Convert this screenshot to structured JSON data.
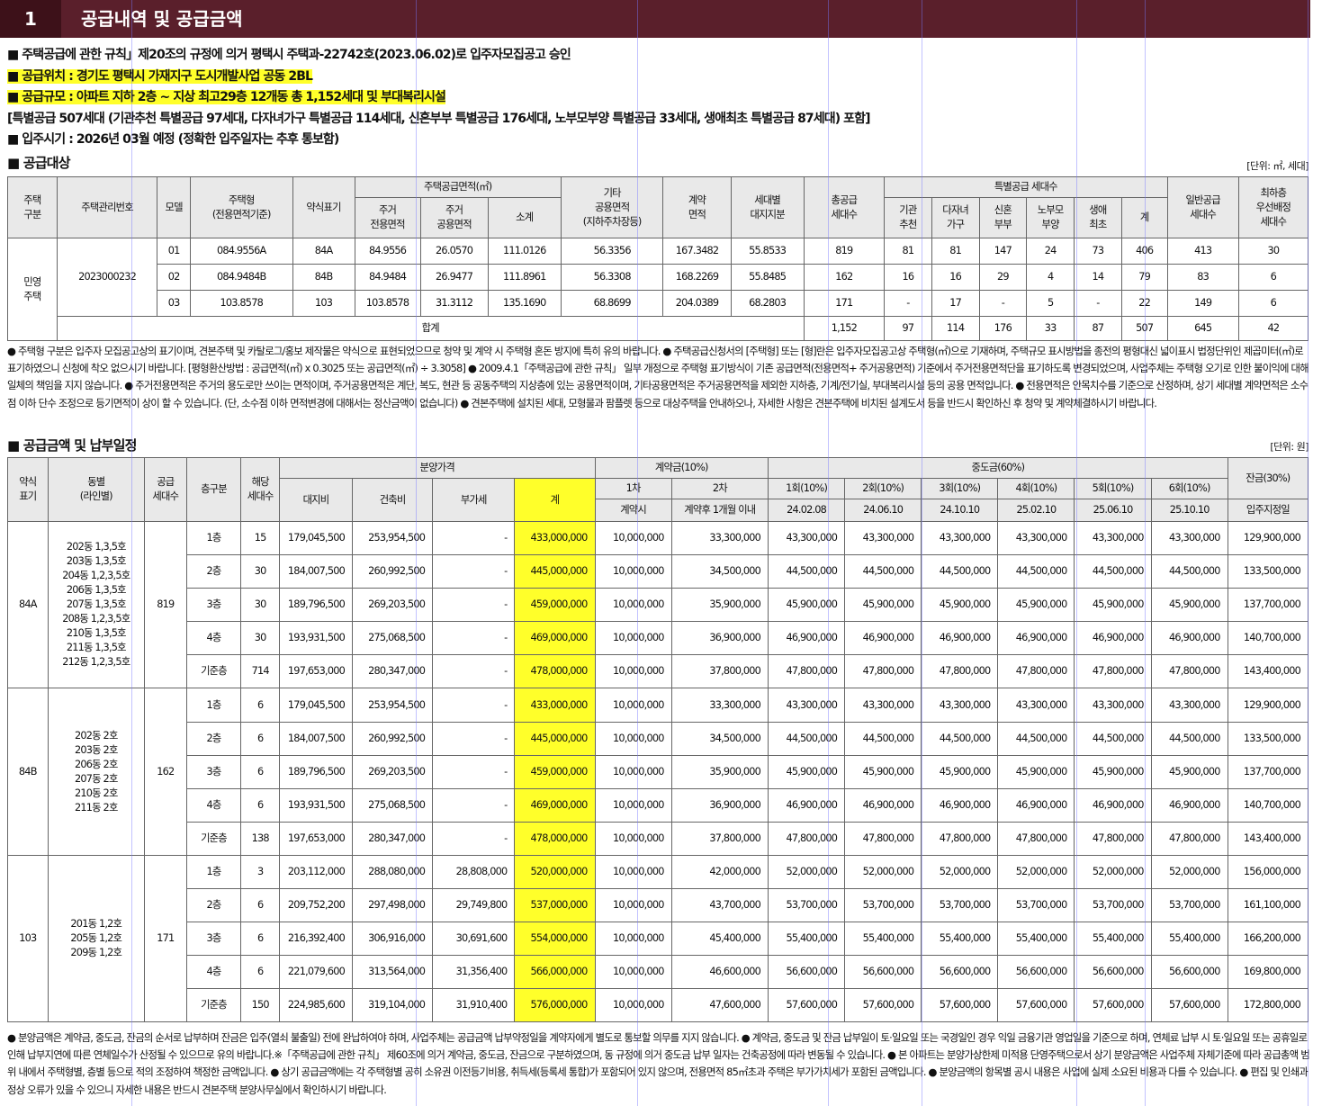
{
  "section": {
    "number": "1",
    "title": "공급내역 및 공급금액"
  },
  "intro": [
    "■ 주택공급에 관한 규칙」제20조의 규정에 의거 평택시 주택과-22742호(2023.06.02)로 입주자모집공고 승인",
    "■ 공급위치 : 경기도 평택시 가재지구 도시개발사업 공동 2BL",
    "■ 공급규모 : 아파트 지하 2층 ~ 지상 최고29층 12개동 총 1,152세대 및 부대복리시설",
    "[특별공급 507세대 (기관추천 특별공급 97세대, 다자녀가구 특별공급 114세대, 신혼부부 특별공급 176세대, 노부모부양 특별공급 33세대, 생애최초 특별공급 87세대) 포함]",
    "■ 입주시기 : 2026년 03월 예정 (정확한 입주일자는 추후 통보함)"
  ],
  "target": {
    "title": "■ 공급대상",
    "unit": "[단위: ㎡, 세대]",
    "h": {
      "type": "주택\n구분",
      "mgmt": "주택관리번호",
      "model": "모델",
      "htype": "주택형\n(전용면적기준)",
      "short": "약식표기",
      "area": "주택공급면적(㎡)",
      "excl": "주거\n전용면적",
      "comm": "주거\n공용면적",
      "sub": "소계",
      "etc": "기타\n공용면적\n(지하주차장등)",
      "contract": "계약\n면적",
      "land": "세대별\n대지지분",
      "total": "총공급\n세대수",
      "special": "특별공급 세대수",
      "inst": "기관\n추천",
      "multi": "다자녀\n가구",
      "newly": "신혼\n부부",
      "elder": "노부모\n부양",
      "first": "생애\n최초",
      "ssum": "계",
      "general": "일반공급\n세대수",
      "lowest": "최하층\n우선배정\n세대수"
    },
    "category": "민영\n주택",
    "mgmt_no": "2023000232",
    "rows": [
      [
        "01",
        "084.9556A",
        "84A",
        "84.9556",
        "26.0570",
        "111.0126",
        "56.3356",
        "167.3482",
        "55.8533",
        "819",
        "81",
        "81",
        "147",
        "24",
        "73",
        "406",
        "413",
        "30"
      ],
      [
        "02",
        "084.9484B",
        "84B",
        "84.9484",
        "26.9477",
        "111.8961",
        "56.3308",
        "168.2269",
        "55.8485",
        "162",
        "16",
        "16",
        "29",
        "4",
        "14",
        "79",
        "83",
        "6"
      ],
      [
        "03",
        "103.8578",
        "103",
        "103.8578",
        "31.3112",
        "135.1690",
        "68.8699",
        "204.0389",
        "68.2803",
        "171",
        "-",
        "17",
        "-",
        "5",
        "-",
        "22",
        "149",
        "6"
      ]
    ],
    "total_label": "합계",
    "total": [
      "1,152",
      "97",
      "114",
      "176",
      "33",
      "87",
      "507",
      "645",
      "42"
    ]
  },
  "notes1": "● 주택형 구분은 입주자 모집공고상의 표기이며, 견본주택 및 카탈로그/홍보 제작물은 약식으로 표현되었으므로 청약 및 계약 시 주택형 혼돈 방지에 특히 유의 바랍니다. ● 주택공급신청서의 [주택형] 또는 [형]란은 입주자모집공고상 주택형(㎡)으로 기재하며, 주택규모 표시방법을 종전의 평형대신 넓이표시 법정단위인 제곱미터(㎡)로 표기하였으니 신청에 착오 없으시기 바랍니다. [평형환산방법 : 공급면적(㎡) x 0.3025 또는 공급면적(㎡) ÷ 3.3058] ● 2009.4.1「주택공급에 관한 규칙」 일부 개정으로 주택형 표기방식이 기존 공급면적(전용면적+ 주거공용면적) 기준에서 주거전용면적단을 표기하도록 변경되었으며, 사업주체는 주택형 오기로 인한 불이익에 대해 일체의 책임을 지지 않습니다. ● 주거전용면적은 주거의 용도로만 쓰이는 면적이며, 주거공용면적은 계단, 복도, 현관 등 공동주택의 지상층에 있는 공용면적이며, 기타공용면적은 주거공용면적을 제외한 지하층, 기계/전기실, 부대복리시설 등의 공용 면적입니다. ● 전용면적은 안목치수를 기준으로 산정하며, 상기 세대별 계약면적은 소수점 이하 단수 조정으로 등기면적이 상이 할 수 있습니다. (단, 소수점 이하 면적변경에 대해서는 정산금액이 없습니다) ● 견본주택에 설치된 세대, 모형물과 팜플렛 등으로 대상주택을 안내하오나, 자세한 사항은 견본주택에 비치된 설계도서 등을 반드시 확인하신 후 청약 및 계약체결하시기 바랍니다.",
  "price": {
    "title": "■ 공급금액 및 납부일정",
    "unit": "[단위: 원]",
    "h": {
      "short": "약식\n표기",
      "dong": "동별\n(라인별)",
      "supply": "공급\n세대수",
      "floor": "층구분",
      "hh": "해당\n세대수",
      "sale": "분양가격",
      "landc": "대지비",
      "build": "건축비",
      "vat": "부가세",
      "sum": "계",
      "contract": "계약금(10%)",
      "c1": "1차",
      "c2": "2차",
      "c1d": "계약시",
      "c2d": "계약후 1개월 이내",
      "mid": "중도금(60%)",
      "m": [
        "1회(10%)",
        "2회(10%)",
        "3회(10%)",
        "4회(10%)",
        "5회(10%)",
        "6회(10%)"
      ],
      "md": [
        "24.02.08",
        "24.06.10",
        "24.10.10",
        "25.02.10",
        "25.06.10",
        "25.10.10"
      ],
      "bal": "잔금(30%)",
      "bald": "입주지정일"
    },
    "groups": [
      {
        "short": "84A",
        "dong": [
          "202동 1,3,5호",
          "203동 1,3,5호",
          "204동 1,2,3,5호",
          "206동 1,3,5호",
          "207동 1,3,5호",
          "208동 1,2,3,5호",
          "210동 1,3,5호",
          "211동 1,3,5호",
          "212동 1,2,3,5호"
        ],
        "supply": "819",
        "rows": [
          [
            "1층",
            "15",
            "179,045,500",
            "253,954,500",
            "-",
            "433,000,000",
            "10,000,000",
            "33,300,000",
            "43,300,000",
            "43,300,000",
            "43,300,000",
            "43,300,000",
            "43,300,000",
            "43,300,000",
            "129,900,000"
          ],
          [
            "2층",
            "30",
            "184,007,500",
            "260,992,500",
            "-",
            "445,000,000",
            "10,000,000",
            "34,500,000",
            "44,500,000",
            "44,500,000",
            "44,500,000",
            "44,500,000",
            "44,500,000",
            "44,500,000",
            "133,500,000"
          ],
          [
            "3층",
            "30",
            "189,796,500",
            "269,203,500",
            "-",
            "459,000,000",
            "10,000,000",
            "35,900,000",
            "45,900,000",
            "45,900,000",
            "45,900,000",
            "45,900,000",
            "45,900,000",
            "45,900,000",
            "137,700,000"
          ],
          [
            "4층",
            "30",
            "193,931,500",
            "275,068,500",
            "-",
            "469,000,000",
            "10,000,000",
            "36,900,000",
            "46,900,000",
            "46,900,000",
            "46,900,000",
            "46,900,000",
            "46,900,000",
            "46,900,000",
            "140,700,000"
          ],
          [
            "기준층",
            "714",
            "197,653,000",
            "280,347,000",
            "-",
            "478,000,000",
            "10,000,000",
            "37,800,000",
            "47,800,000",
            "47,800,000",
            "47,800,000",
            "47,800,000",
            "47,800,000",
            "47,800,000",
            "143,400,000"
          ]
        ]
      },
      {
        "short": "84B",
        "dong": [
          "202동 2호",
          "203동 2호",
          "206동 2호",
          "207동 2호",
          "210동 2호",
          "211동 2호"
        ],
        "supply": "162",
        "rows": [
          [
            "1층",
            "6",
            "179,045,500",
            "253,954,500",
            "-",
            "433,000,000",
            "10,000,000",
            "33,300,000",
            "43,300,000",
            "43,300,000",
            "43,300,000",
            "43,300,000",
            "43,300,000",
            "43,300,000",
            "129,900,000"
          ],
          [
            "2층",
            "6",
            "184,007,500",
            "260,992,500",
            "-",
            "445,000,000",
            "10,000,000",
            "34,500,000",
            "44,500,000",
            "44,500,000",
            "44,500,000",
            "44,500,000",
            "44,500,000",
            "44,500,000",
            "133,500,000"
          ],
          [
            "3층",
            "6",
            "189,796,500",
            "269,203,500",
            "-",
            "459,000,000",
            "10,000,000",
            "35,900,000",
            "45,900,000",
            "45,900,000",
            "45,900,000",
            "45,900,000",
            "45,900,000",
            "45,900,000",
            "137,700,000"
          ],
          [
            "4층",
            "6",
            "193,931,500",
            "275,068,500",
            "-",
            "469,000,000",
            "10,000,000",
            "36,900,000",
            "46,900,000",
            "46,900,000",
            "46,900,000",
            "46,900,000",
            "46,900,000",
            "46,900,000",
            "140,700,000"
          ],
          [
            "기준층",
            "138",
            "197,653,000",
            "280,347,000",
            "-",
            "478,000,000",
            "10,000,000",
            "37,800,000",
            "47,800,000",
            "47,800,000",
            "47,800,000",
            "47,800,000",
            "47,800,000",
            "47,800,000",
            "143,400,000"
          ]
        ]
      },
      {
        "short": "103",
        "dong": [
          "201동 1,2호",
          "205동 1,2호",
          "209동 1,2호"
        ],
        "supply": "171",
        "rows": [
          [
            "1층",
            "3",
            "203,112,000",
            "288,080,000",
            "28,808,000",
            "520,000,000",
            "10,000,000",
            "42,000,000",
            "52,000,000",
            "52,000,000",
            "52,000,000",
            "52,000,000",
            "52,000,000",
            "52,000,000",
            "156,000,000"
          ],
          [
            "2층",
            "6",
            "209,752,200",
            "297,498,000",
            "29,749,800",
            "537,000,000",
            "10,000,000",
            "43,700,000",
            "53,700,000",
            "53,700,000",
            "53,700,000",
            "53,700,000",
            "53,700,000",
            "53,700,000",
            "161,100,000"
          ],
          [
            "3층",
            "6",
            "216,392,400",
            "306,916,000",
            "30,691,600",
            "554,000,000",
            "10,000,000",
            "45,400,000",
            "55,400,000",
            "55,400,000",
            "55,400,000",
            "55,400,000",
            "55,400,000",
            "55,400,000",
            "166,200,000"
          ],
          [
            "4층",
            "6",
            "221,079,600",
            "313,564,000",
            "31,356,400",
            "566,000,000",
            "10,000,000",
            "46,600,000",
            "56,600,000",
            "56,600,000",
            "56,600,000",
            "56,600,000",
            "56,600,000",
            "56,600,000",
            "169,800,000"
          ],
          [
            "기준층",
            "150",
            "224,985,600",
            "319,104,000",
            "31,910,400",
            "576,000,000",
            "10,000,000",
            "47,600,000",
            "57,600,000",
            "57,600,000",
            "57,600,000",
            "57,600,000",
            "57,600,000",
            "57,600,000",
            "172,800,000"
          ]
        ]
      }
    ]
  },
  "notes2": "● 분양금액은 계약금, 중도금, 잔금의 순서로 납부하며 잔금은 입주(열쇠 불출일) 전에 완납하여야 하며, 사업주체는 공급금액 납부약정일을 계약자에게 별도로 통보할 의무를 지지 않습니다. ● 계약금, 중도금 및 잔금 납부일이 토·일요일 또는 국경일인 경우 익일 금융기관 영업일을 기준으로 하며, 연체료 납부 시 토·일요일 또는 공휴일로 인해 납부지연에 따른 연체일수가 산정될 수 있으므로 유의 바랍니다.※「주택공급에 관한 규칙」 제60조에 의거 계약금, 중도금, 잔금으로 구분하였으며, 동 규정에 의거 중도금 납부 일자는 건축공정에 따라 변동될 수 있습니다. ● 본 아파트는 분양가상한제 미적용 단영주택으로서 상기 분양금액은 사업주체 자체기준에 따라 공급총액 범위 내에서 주택형별, 층별 등으로 적의 조정하여 책정한 금액입니다. ● 상기 공급금액에는 각 주택형별 공히 소유권 이전등기비용, 취득세(등록세 통합)가 포함되어 있지 않으며, 전용면적 85㎡초과 주택은 부가가치세가 포함된 금액입니다. ● 분양금액의 항목별 공시 내용은 사업에 실제 소요된 비용과 다를 수 있습니다. ● 편집 및 인쇄과정상 오류가 있을 수 있으니 자세한 내용은 반드시 견본주택 분양사무실에서 확인하시기 바랍니다."
}
